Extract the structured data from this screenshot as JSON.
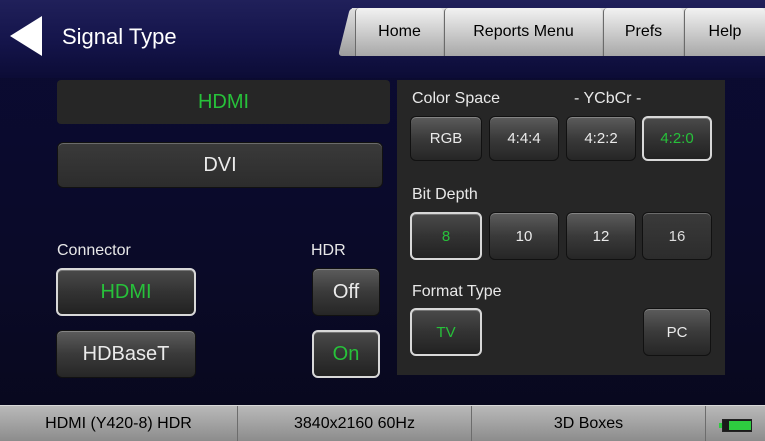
{
  "header": {
    "title": "Signal Type",
    "tabs": [
      "Home",
      "Reports Menu",
      "Prefs",
      "Help"
    ]
  },
  "signal": {
    "current": "HDMI",
    "alt_button": "DVI"
  },
  "connector": {
    "label": "Connector",
    "options": [
      "HDMI",
      "HDBaseT"
    ],
    "selected": "HDMI"
  },
  "hdr": {
    "label": "HDR",
    "options": [
      "Off",
      "On"
    ],
    "selected": "On"
  },
  "color_space": {
    "label": "Color Space",
    "sublabel": "- YCbCr -",
    "options": [
      "RGB",
      "4:4:4",
      "4:2:2",
      "4:2:0"
    ],
    "selected": "4:2:0"
  },
  "bit_depth": {
    "label": "Bit Depth",
    "options": [
      "8",
      "10",
      "12",
      "16"
    ],
    "selected": "8"
  },
  "format_type": {
    "label": "Format Type",
    "options": [
      "TV",
      "PC"
    ],
    "selected": "TV"
  },
  "status_bar": {
    "signal": "HDMI (Y420-8) HDR",
    "resolution": "3840x2160 60Hz",
    "boxes": "3D Boxes"
  },
  "colors": {
    "accent_green": "#27c13a",
    "battery_green": "#2ecc40"
  }
}
